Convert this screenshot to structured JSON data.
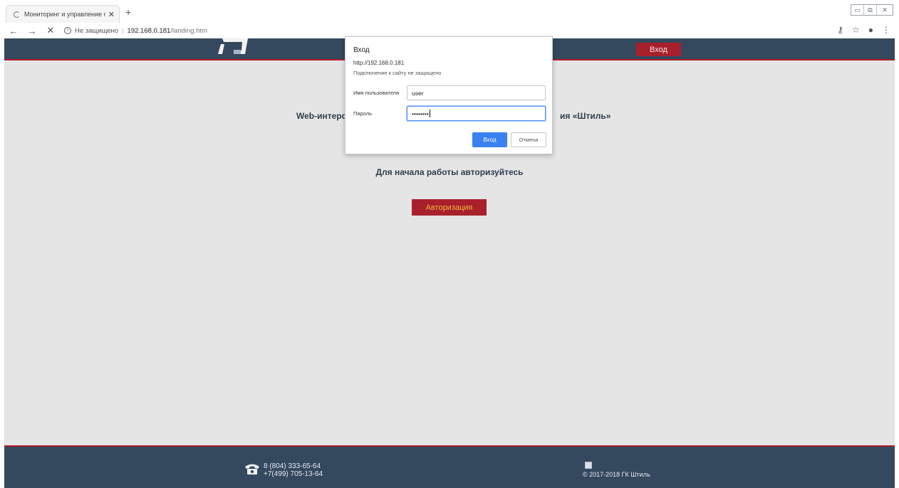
{
  "browser": {
    "tab_title": "Мониторинг и управление сист",
    "tab_close": "✕",
    "new_tab": "+",
    "back": "←",
    "forward": "→",
    "stop": "✕",
    "insecure_label": "Не защищено",
    "url_host": "192.168.0.181",
    "url_path": "/landing.htm",
    "window_controls": [
      "▭",
      "⧉",
      "✕"
    ]
  },
  "site": {
    "header_login_label": "Вход",
    "intro_title_left": "Web-интерф",
    "intro_title_right": "ия «Штиль»",
    "auth_hint": "Для начала работы авторизуйтесь",
    "auth_button_label": "Авторизация",
    "footer": {
      "phone_1": "8 (804) 333-65-64",
      "phone_2": "+7(499) 705-13-64",
      "copyright": "© 2017-2018 ГК Штиль"
    }
  },
  "dialog": {
    "title": "Вход",
    "url": "http://192.168.0.181",
    "warning": "Подключение к сайту не защищено",
    "username_label": "Имя пользователя",
    "username_value": "user",
    "password_label": "Пароль",
    "password_value": "••••••••",
    "ok_label": "Вход",
    "cancel_label": "Отмена"
  },
  "colors": {
    "header_bg": "#34495e",
    "accent_red": "#a8202c",
    "primary_blue": "#3b82f0",
    "page_bg": "#e5e5e5"
  }
}
